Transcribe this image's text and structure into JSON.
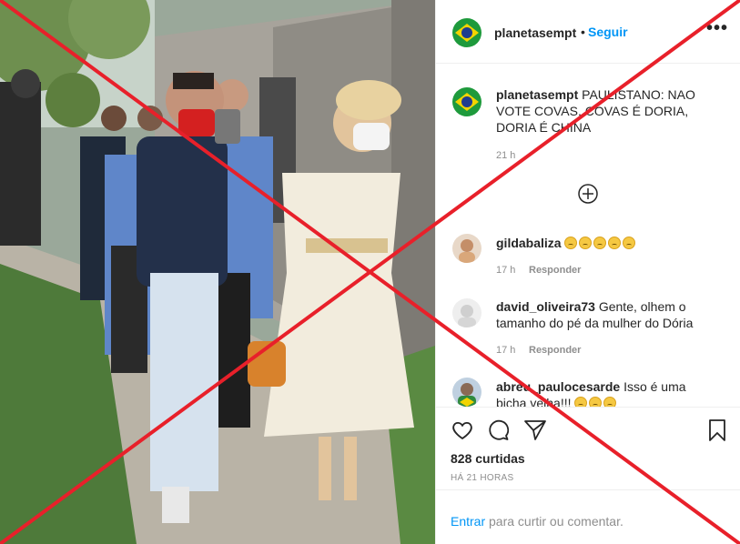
{
  "post": {
    "username": "planetasempt",
    "follow_dot": "•",
    "follow_label": "Seguir",
    "more_label": "•••"
  },
  "caption": {
    "username": "planetasempt",
    "text": "PAULISTANO: NAO VOTE COVAS, COVAS É DORIA, DORIA É CHINA",
    "time": "21 h"
  },
  "comments": [
    {
      "username": "gildabaliza",
      "text": "",
      "emoji_count": 5,
      "time": "17 h",
      "reply": "Responder"
    },
    {
      "username": "david_oliveira73",
      "text": "Gente, olhem o tamanho do pé da mulher do Dória",
      "time": "17 h",
      "reply": "Responder"
    },
    {
      "username": "abreu_paulocesarde",
      "text": "Isso é uma bicha velha!!!",
      "emoji_count": 3
    }
  ],
  "actions": {
    "likes": "828 curtidas",
    "timestamp": "HÁ 21 HORAS"
  },
  "login": {
    "link": "Entrar",
    "text": " para curtir ou comentar."
  },
  "icons": [
    "brazil-flag-avatar",
    "more-icon",
    "add-comments-icon",
    "heart-icon",
    "comment-icon",
    "share-icon",
    "bookmark-icon"
  ],
  "colors": {
    "accent": "#0095f6",
    "muted": "#8e8e8e",
    "cross": "#e8202a"
  }
}
